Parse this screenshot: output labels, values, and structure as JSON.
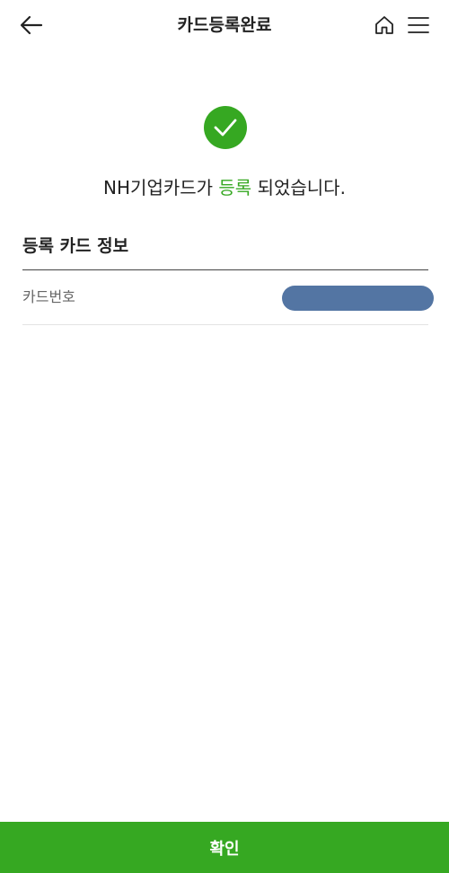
{
  "header": {
    "title": "카드등록완료",
    "back_icon": "arrow-left-icon",
    "home_icon": "home-icon",
    "menu_icon": "hamburger-menu-icon"
  },
  "result": {
    "icon": "check-circle-icon",
    "message_prefix": "NH기업카드가 ",
    "message_highlight": "등록",
    "message_suffix": " 되었습니다."
  },
  "card_info": {
    "section_title": "등록 카드 정보",
    "rows": [
      {
        "label": "카드번호",
        "value": ""
      }
    ]
  },
  "footer": {
    "confirm_label": "확인"
  },
  "colors": {
    "accent": "#36a822",
    "masked": "#5375a3",
    "text": "#222222",
    "label": "#666666"
  }
}
